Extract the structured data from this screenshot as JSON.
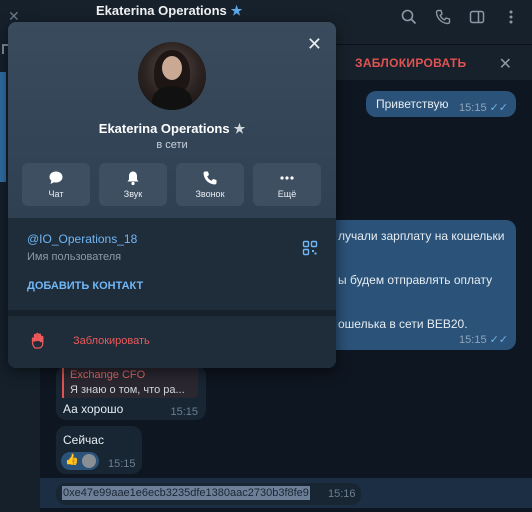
{
  "chat": {
    "title": "Ekaterina Operations",
    "block_banner": "ЗАБЛОКИРОВАТЬ",
    "messages": [
      {
        "text": "Приветствую",
        "time": "15:15"
      },
      {
        "line1": "лучали зарплату на кошельки",
        "line2": "ы будем отправлять оплату",
        "line3": "ошелька в сети BEB20.",
        "time": "15:15"
      },
      {
        "reply_author": "Exchange CFO",
        "reply_text": "Я знаю о том, что ра...",
        "text": "Аа хорошо",
        "time": "15:15"
      },
      {
        "text": "Сейчас",
        "time": "15:15"
      },
      {
        "text": "0xe47e99aae1e6ecb3235dfe1380aac2730b3f8fe9",
        "time": "15:16"
      }
    ]
  },
  "profile": {
    "name": "Ekaterina Operations",
    "status": "в сети",
    "actions": [
      {
        "label": "Чат",
        "icon": "chat-icon"
      },
      {
        "label": "Звук",
        "icon": "bell-icon"
      },
      {
        "label": "Звонок",
        "icon": "phone-icon"
      },
      {
        "label": "Ещё",
        "icon": "more-icon"
      }
    ],
    "username": "@IO_Operations_18",
    "username_caption": "Имя пользователя",
    "add_contact": "ДОБАВИТЬ КОНТАКТ",
    "block": "Заблокировать"
  },
  "colors": {
    "accent": "#71b7f5",
    "danger": "#e05353",
    "outgoing_bubble": "#2b5278",
    "incoming_bubble": "#182533"
  }
}
